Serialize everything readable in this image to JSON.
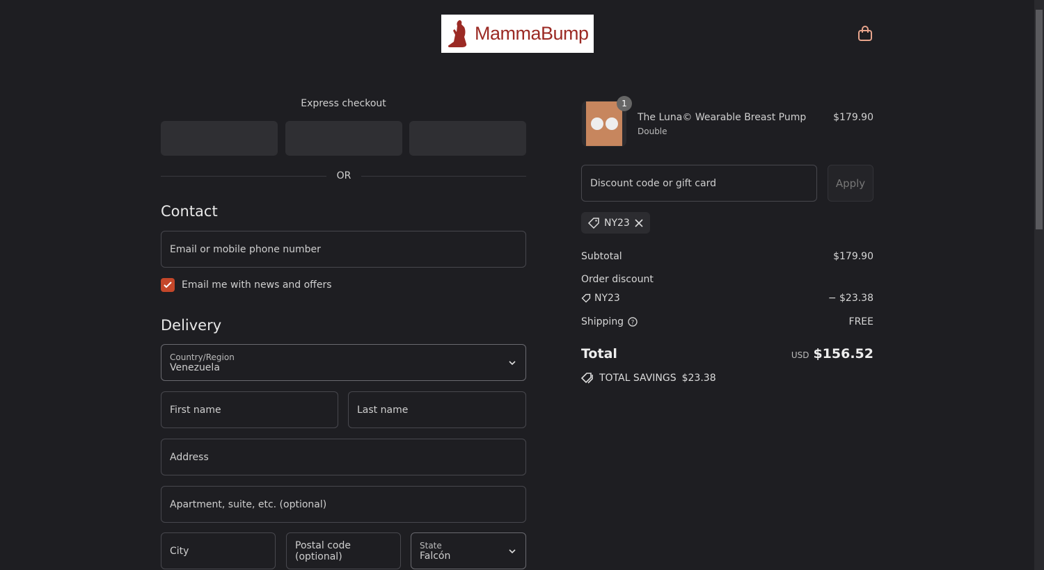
{
  "header": {
    "logo_text": "MammaBump",
    "cart_icon": "shopping-bag-icon"
  },
  "express": {
    "title": "Express checkout",
    "or": "OR"
  },
  "contact": {
    "heading": "Contact",
    "email_placeholder": "Email or mobile phone number",
    "newsletter_label": "Email me with news and offers",
    "newsletter_checked": true
  },
  "delivery": {
    "heading": "Delivery",
    "country_label": "Country/Region",
    "country_value": "Venezuela",
    "first_name": "First name",
    "last_name": "Last name",
    "address": "Address",
    "apartment": "Apartment, suite, etc. (optional)",
    "city": "City",
    "postal": "Postal code (optional)",
    "state_label": "State",
    "state_value": "Falcón"
  },
  "cart": {
    "item": {
      "qty": "1",
      "name": "The Luna© Wearable Breast Pump",
      "variant": "Double",
      "price": "$179.90"
    },
    "discount_placeholder": "Discount code or gift card",
    "apply": "Apply",
    "applied_code": "NY23",
    "subtotal_label": "Subtotal",
    "subtotal": "$179.90",
    "order_discount_label": "Order discount",
    "discount_code": "NY23",
    "discount_amount": "− $23.38",
    "shipping_label": "Shipping",
    "shipping": "FREE",
    "total_label": "Total",
    "currency": "USD",
    "total": "$156.52",
    "savings_label": "TOTAL SAVINGS",
    "savings": "$23.38"
  },
  "colors": {
    "accent": "#c4472a",
    "bg": "#1e1e22"
  }
}
